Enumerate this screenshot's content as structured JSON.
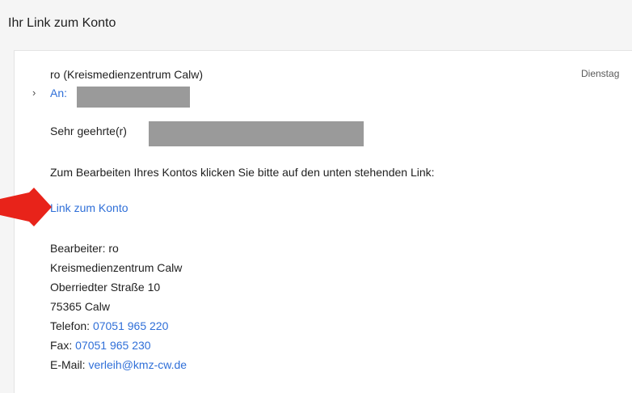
{
  "header": {
    "subject": "Ihr Link zum Konto"
  },
  "message": {
    "sender": "ro (Kreismedienzentrum Calw)",
    "date": "Dienstag",
    "expand_glyph": "›",
    "to_label": "An:",
    "greeting": "Sehr geehrte(r)",
    "instruction": "Zum Bearbeiten Ihres Kontos klicken Sie bitte auf den unten stehenden Link:",
    "link_text": "Link zum Konto"
  },
  "signature": {
    "editor": "Bearbeiter: ro",
    "org": "Kreismedienzentrum Calw",
    "street": "Oberriedter Straße 10",
    "city": "75365 Calw",
    "phone_label": "Telefon: ",
    "phone": "07051 965 220",
    "fax_label": "Fax: ",
    "fax": "07051 965 230",
    "email_label": "E-Mail: ",
    "email": "verleih@kmz-cw.de"
  },
  "colors": {
    "link": "#2f6fd8",
    "arrow": "#e8231a",
    "redaction": "#9a9a9a"
  },
  "icons": {
    "expand": "chevron-right-icon",
    "annotation": "red-arrow-icon"
  }
}
